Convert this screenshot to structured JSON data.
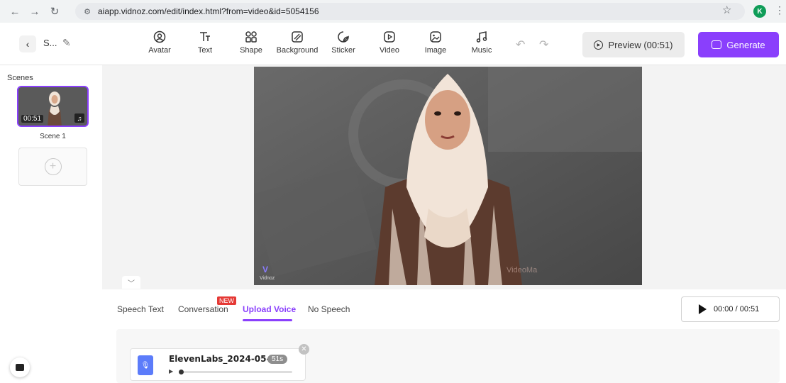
{
  "browser": {
    "url": "aiapp.vidnoz.com/edit/index.html?from=video&id=5054156",
    "profile_initial": "K"
  },
  "toolbar": {
    "project_name": "S...",
    "tools": [
      {
        "label": "Avatar",
        "icon": "avatar-icon"
      },
      {
        "label": "Text",
        "icon": "text-icon"
      },
      {
        "label": "Shape",
        "icon": "shape-icon"
      },
      {
        "label": "Background",
        "icon": "background-icon"
      },
      {
        "label": "Sticker",
        "icon": "sticker-icon"
      },
      {
        "label": "Video",
        "icon": "video-icon"
      },
      {
        "label": "Image",
        "icon": "image-icon"
      },
      {
        "label": "Music",
        "icon": "music-icon"
      }
    ],
    "preview_label": "Preview (00:51)",
    "generate_label": "Generate"
  },
  "scenes": {
    "title": "Scenes",
    "items": [
      {
        "label": "Scene 1",
        "duration": "00:51"
      }
    ]
  },
  "canvas": {
    "watermark": "Vidnoz"
  },
  "speech_tabs": {
    "tabs": [
      "Speech Text",
      "Conversation",
      "Upload Voice",
      "No Speech"
    ],
    "active": "Upload Voice",
    "new_badge": "NEW",
    "player_time": "00:00 / 00:51"
  },
  "voice_file": {
    "name": "ElevenLabs_2024-05-3...",
    "duration": "51s"
  },
  "colors": {
    "accent": "#8a3ffc",
    "badge_red": "#e53935"
  }
}
